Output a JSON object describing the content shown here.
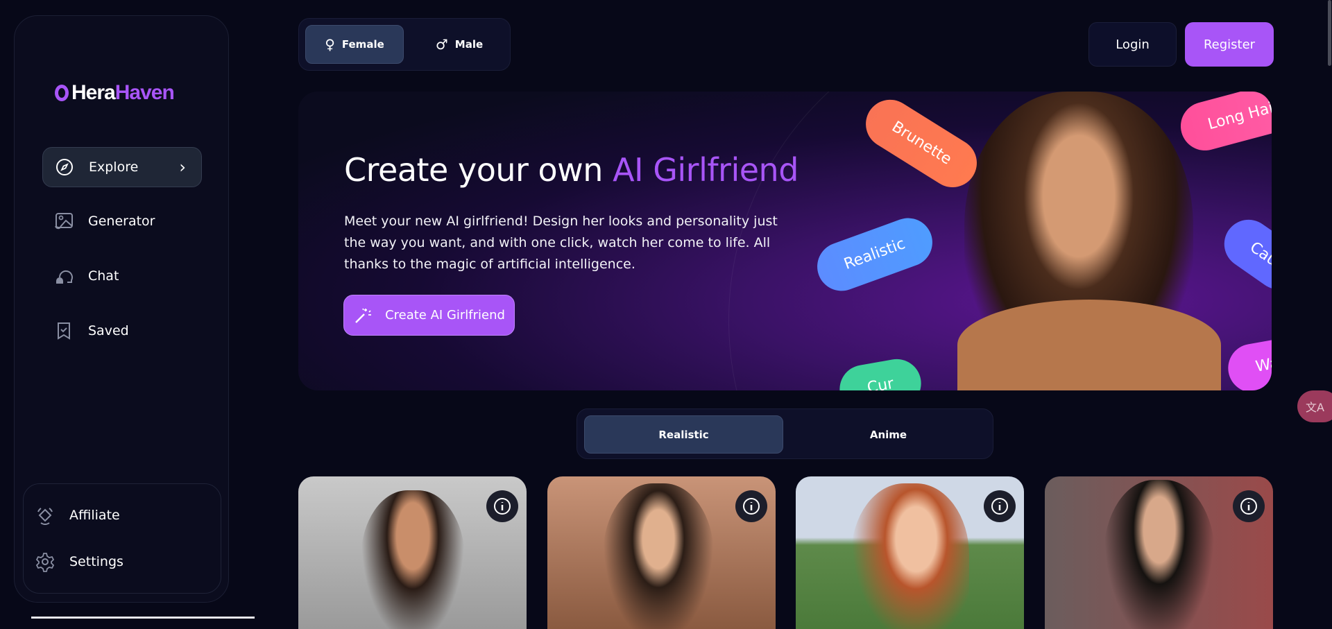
{
  "brand": {
    "part1": "Hera",
    "part2": "Haven",
    "accent": "#a855f7"
  },
  "sidebar": {
    "items": [
      {
        "label": "Explore",
        "icon": "compass-icon",
        "active": true
      },
      {
        "label": "Generator",
        "icon": "image-generator-icon"
      },
      {
        "label": "Chat",
        "icon": "chat-bubbles-icon"
      },
      {
        "label": "Saved",
        "icon": "bookmark-check-icon"
      }
    ],
    "bottom": [
      {
        "label": "Affiliate",
        "icon": "affiliate-icon"
      },
      {
        "label": "Settings",
        "icon": "gear-icon"
      }
    ]
  },
  "gender": {
    "options": [
      {
        "label": "Female",
        "icon": "female-symbol-icon",
        "selected": true
      },
      {
        "label": "Male",
        "icon": "male-symbol-icon"
      }
    ]
  },
  "header": {
    "login": "Login",
    "register": "Register"
  },
  "hero": {
    "title_plain": "Create your own ",
    "title_accent": "AI Girlfriend",
    "description": "Meet your new AI girlfriend! Design her looks and personality just the way you want, and with one click, watch her come to life. All thanks to the magic of artificial intelligence.",
    "cta": "Create AI Girlfriend",
    "tags": [
      "Brunette",
      "Long Hair",
      "Realistic",
      "Cau",
      "Cur",
      "Wa"
    ]
  },
  "style": {
    "options": [
      {
        "label": "Realistic",
        "selected": true
      },
      {
        "label": "Anime"
      }
    ]
  },
  "cards": [
    {
      "icon": "info-icon"
    },
    {
      "icon": "info-icon"
    },
    {
      "icon": "info-icon"
    },
    {
      "icon": "info-icon"
    }
  ],
  "translate": {
    "icon": "translate-icon"
  }
}
